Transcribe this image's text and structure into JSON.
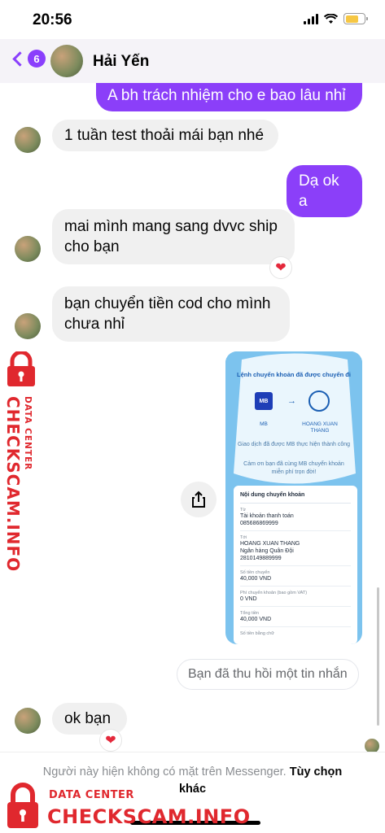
{
  "status_bar": {
    "time": "20:56"
  },
  "header": {
    "back_count": "6",
    "contact_name": "Hải Yến"
  },
  "messages": [
    {
      "from": "me",
      "text": "A bh trách nhiệm cho e bao lâu nhỉ"
    },
    {
      "from": "them",
      "text": "1 tuần test thoải mái bạn nhé"
    },
    {
      "from": "me",
      "text": "Dạ ok a"
    },
    {
      "from": "them",
      "text": "mai mình mang sang dvvc ship cho bạn",
      "reaction": "❤"
    },
    {
      "from": "them",
      "text": "bạn chuyển tiền cod cho mình chưa nhỉ"
    },
    {
      "from": "them",
      "text": "ok  bạn",
      "reaction": "❤"
    }
  ],
  "receipt": {
    "title": "Lệnh chuyển khoản đã được chuyển đi",
    "from_bank": "MB",
    "to_name": "HOANG XUAN THANG",
    "message_1": "Giao dịch đã được MB thực hiện thành công",
    "message_2": "Cảm ơn bạn đã cùng MB chuyển khoản miễn phí trọn đời!",
    "card_title": "Nội dung chuyển khoản",
    "rows": [
      {
        "key": "Từ",
        "value": "Tài khoản thanh toán\n085686869999"
      },
      {
        "key": "Tới",
        "value": "HOANG XUAN THANG\nNgân hàng Quân Đội\n2810149889999"
      },
      {
        "key": "Số tiền chuyển",
        "value": "40,000 VND"
      },
      {
        "key": "Phí chuyển khoản (bao gồm VAT)",
        "value": "0 VND"
      },
      {
        "key": "Tổng tiền",
        "value": "40,000 VND"
      },
      {
        "key": "Số tiền bằng chữ",
        "value": ""
      }
    ]
  },
  "recall_notice": "Bạn đã thu hồi một tin nhắn",
  "footer": {
    "notice": "Người này hiện không có mặt trên Messenger.",
    "action": "Tùy chọn khác"
  },
  "watermark": {
    "small": "DATA CENTER",
    "big": "CHECKSCAM.INFO"
  },
  "colors": {
    "accent": "#8b3ff9",
    "watermark": "#e0282e"
  }
}
